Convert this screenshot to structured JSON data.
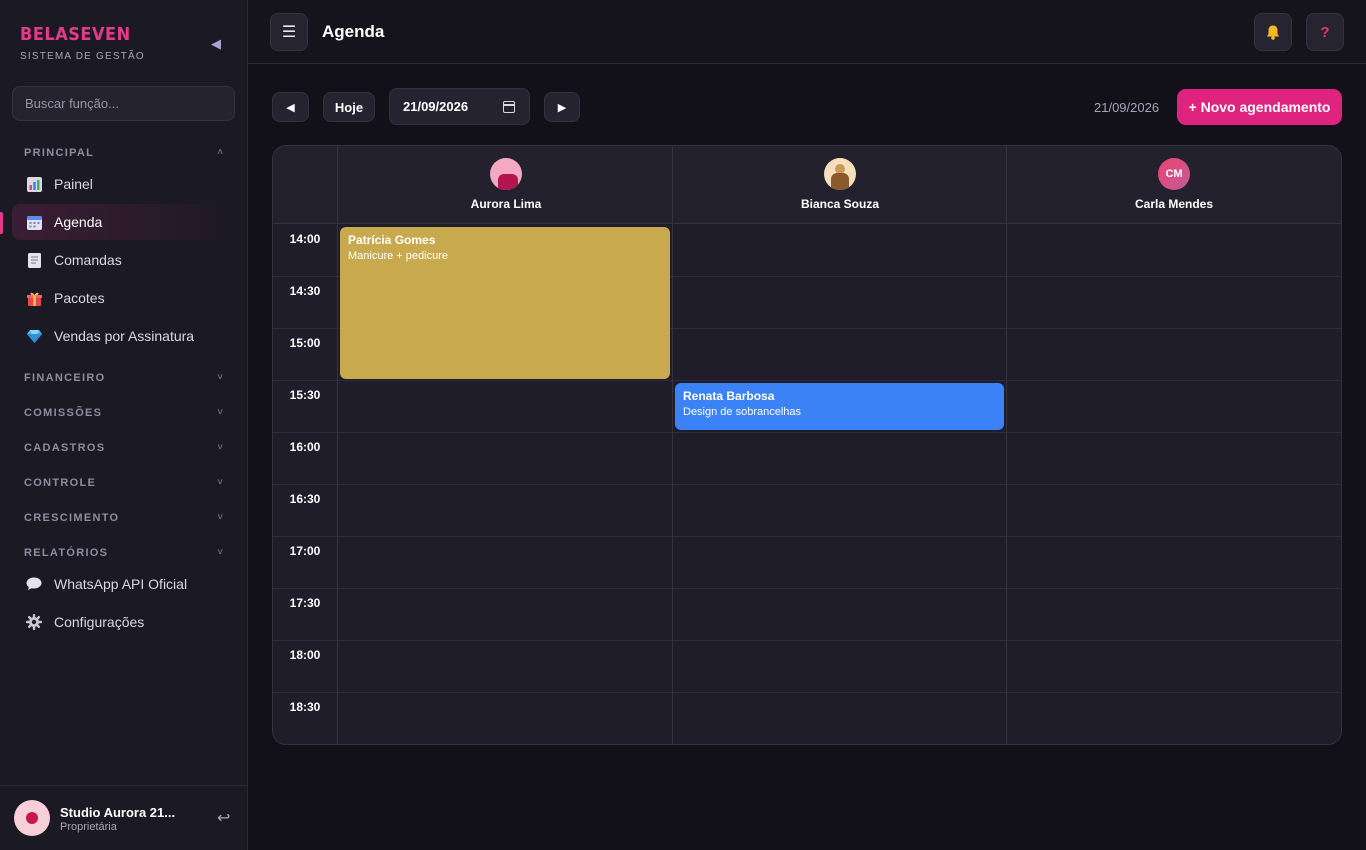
{
  "brand": {
    "name": "BELASEVEN",
    "subtitle": "SISTEMA DE GESTÃO"
  },
  "search": {
    "placeholder": "Buscar função..."
  },
  "sidebar": {
    "principal_title": "PRINCIPAL",
    "items": [
      {
        "label": "Painel",
        "icon": "chart-icon"
      },
      {
        "label": "Agenda",
        "icon": "calendar-icon",
        "active": true
      },
      {
        "label": "Comandas",
        "icon": "receipt-icon"
      },
      {
        "label": "Pacotes",
        "icon": "gift-icon"
      },
      {
        "label": "Vendas por Assinatura",
        "icon": "diamond-icon"
      }
    ],
    "sections": [
      "FINANCEIRO",
      "COMISSÕES",
      "CADASTROS",
      "CONTROLE",
      "CRESCIMENTO",
      "RELATÓRIOS"
    ],
    "bottom_items": [
      {
        "label": "WhatsApp API Oficial",
        "icon": "speech-bubble-icon"
      },
      {
        "label": "Configurações",
        "icon": "gear-icon"
      }
    ]
  },
  "user": {
    "name": "Studio Aurora 21...",
    "role": "Proprietária"
  },
  "header": {
    "title": "Agenda"
  },
  "toolbar": {
    "prev": "◀",
    "today": "Hoje",
    "date_value": "21/09/2026",
    "next": "▶",
    "date_label": "21/09/2026",
    "new_button": "+ Novo agendamento"
  },
  "calendar": {
    "staff": [
      {
        "name": "Aurora Lima",
        "initials": ""
      },
      {
        "name": "Bianca Souza",
        "initials": ""
      },
      {
        "name": "Carla Mendes",
        "initials": "CM"
      }
    ],
    "times": [
      "14:00",
      "14:30",
      "15:00",
      "15:30",
      "16:00",
      "16:30",
      "17:00",
      "17:30",
      "18:00",
      "18:30"
    ],
    "appointments": [
      {
        "client": "Patrícia Gomes",
        "service": "Manicure + pedicure",
        "staff": "Aurora Lima",
        "start": "14:00",
        "end": "15:30",
        "color": "#c9a94d"
      },
      {
        "client": "Renata Barbosa",
        "service": "Design de sobrancelhas",
        "staff": "Bianca Souza",
        "start": "15:30",
        "end": "16:00",
        "color": "#3b82f6"
      }
    ]
  },
  "colors": {
    "accent": "#e0237f",
    "background": "#12111a",
    "sidebar": "#1b1a24"
  }
}
